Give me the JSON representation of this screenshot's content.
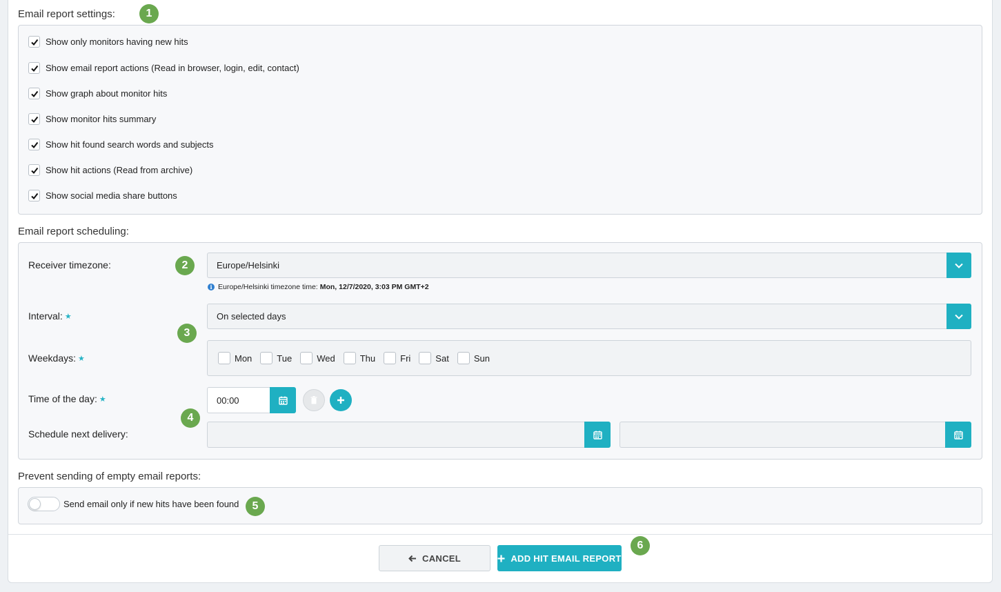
{
  "settings": {
    "title": "Email report settings:",
    "badge": "1",
    "checkboxes": [
      {
        "label": "Show only monitors having new hits",
        "checked": true
      },
      {
        "label": "Show email report actions (Read in browser, login, edit, contact)",
        "checked": true
      },
      {
        "label": "Show graph about monitor hits",
        "checked": true
      },
      {
        "label": "Show monitor hits summary",
        "checked": true
      },
      {
        "label": "Show hit found search words and subjects",
        "checked": true
      },
      {
        "label": "Show hit actions (Read from archive)",
        "checked": true
      },
      {
        "label": "Show social media share buttons",
        "checked": true
      }
    ]
  },
  "scheduling": {
    "title": "Email report scheduling:",
    "timezone_label": "Receiver timezone:",
    "timezone_badge": "2",
    "timezone_value": "Europe/Helsinki",
    "timezone_note_prefix": "Europe/Helsinki timezone time:",
    "timezone_note_time": "Mon, 12/7/2020, 3:03 PM GMT+2",
    "interval_label": "Interval:",
    "interval_value": "On selected days",
    "interval_badge": "3",
    "weekdays_label": "Weekdays:",
    "weekdays": [
      "Mon",
      "Tue",
      "Wed",
      "Thu",
      "Fri",
      "Sat",
      "Sun"
    ],
    "time_label": "Time of the day:",
    "time_value": "00:00",
    "time_badge": "4",
    "next_delivery_label": "Schedule next delivery:",
    "required_mark": "★"
  },
  "prevent": {
    "title": "Prevent sending of empty email reports:",
    "toggle_label": "Send email only if new hits have been found",
    "toggle_on": false,
    "badge": "5"
  },
  "footer": {
    "cancel_label": "CANCEL",
    "add_label": "ADD HIT EMAIL REPORT",
    "badge": "6"
  },
  "colors": {
    "accent": "#1fb0c2",
    "badge": "#6aa84f",
    "info": "#2f7fd0"
  }
}
